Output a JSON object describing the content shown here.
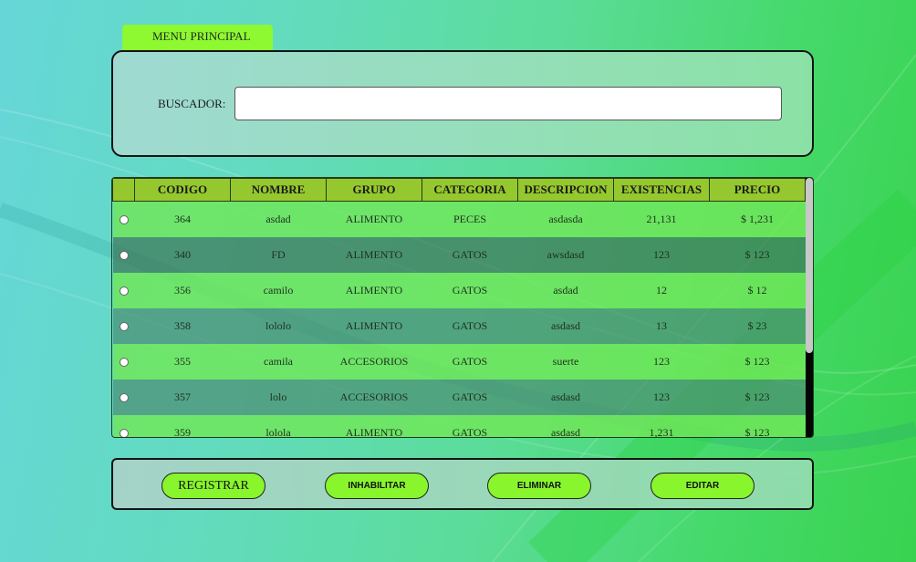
{
  "tab": {
    "label": "MENU PRINCIPAL"
  },
  "search": {
    "label": "BUSCADOR:",
    "value": "",
    "placeholder": ""
  },
  "table": {
    "columns": [
      "",
      "CODIGO",
      "NOMBRE",
      "GRUPO",
      "CATEGORIA",
      "DESCRIPCION",
      "EXISTENCIAS",
      "PRECIO"
    ],
    "rows": [
      {
        "codigo": "364",
        "nombre": "asdad",
        "grupo": "ALIMENTO",
        "categoria": "PECES",
        "descripcion": "asdasda",
        "existencias": "21,131",
        "precio": "$ 1,231"
      },
      {
        "codigo": "340",
        "nombre": "FD",
        "grupo": "ALIMENTO",
        "categoria": "GATOS",
        "descripcion": "awsdasd",
        "existencias": "123",
        "precio": "$ 123"
      },
      {
        "codigo": "356",
        "nombre": "camilo",
        "grupo": "ALIMENTO",
        "categoria": "GATOS",
        "descripcion": "asdad",
        "existencias": "12",
        "precio": "$ 12"
      },
      {
        "codigo": "358",
        "nombre": "lololo",
        "grupo": "ALIMENTO",
        "categoria": "GATOS",
        "descripcion": "asdasd",
        "existencias": "13",
        "precio": "$ 23"
      },
      {
        "codigo": "355",
        "nombre": "camila",
        "grupo": "ACCESORIOS",
        "categoria": "GATOS",
        "descripcion": "suerte",
        "existencias": "123",
        "precio": "$ 123"
      },
      {
        "codigo": "357",
        "nombre": "lolo",
        "grupo": "ACCESORIOS",
        "categoria": "GATOS",
        "descripcion": "asdasd",
        "existencias": "123",
        "precio": "$ 123"
      },
      {
        "codigo": "359",
        "nombre": "lolola",
        "grupo": "ALIMENTO",
        "categoria": "GATOS",
        "descripcion": "asdasd",
        "existencias": "1,231",
        "precio": "$ 123"
      }
    ]
  },
  "actions": {
    "registrar": "REGISTRAR",
    "inhabilitar": "INHABILITAR",
    "eliminar": "ELIMINAR",
    "editar": "EDITAR"
  },
  "colors": {
    "accent": "#8ef830",
    "header": "#95c82e",
    "row_light": "#70e658",
    "row_dark": "#3e7658"
  }
}
